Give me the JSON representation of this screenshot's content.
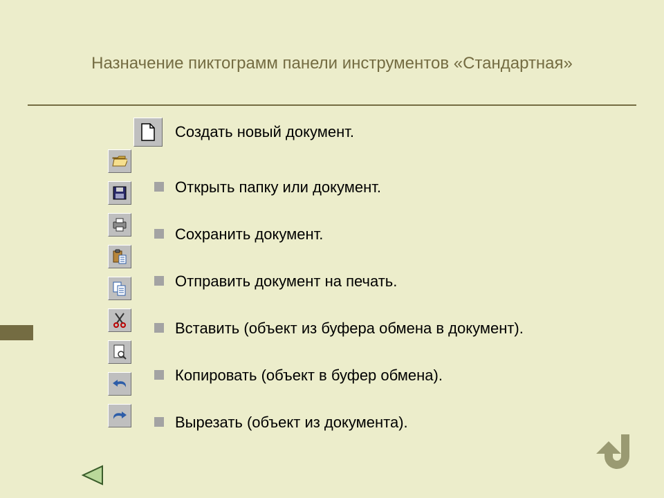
{
  "title": "Назначение пиктограмм панели инструментов «Стандартная»",
  "items": [
    {
      "label": "Создать новый документ.",
      "icon": "new-document-icon"
    },
    {
      "label": "Открыть папку или документ.",
      "icon": "open-folder-icon"
    },
    {
      "label": "Сохранить документ.",
      "icon": "save-icon"
    },
    {
      "label": "Отправить документ на печать.",
      "icon": "print-icon"
    },
    {
      "label": "Вставить (объект из буфера обмена в документ).",
      "icon": "paste-icon"
    },
    {
      "label": "Копировать (объект в буфер обмена).",
      "icon": "copy-icon"
    },
    {
      "label": "Вырезать (объект из документа).",
      "icon": "cut-icon"
    }
  ],
  "icon_column": [
    "open-folder-icon",
    "save-icon",
    "print-icon",
    "paste-icon",
    "copy-icon",
    "cut-icon",
    "preview-icon",
    "undo-icon",
    "redo-icon"
  ],
  "colors": {
    "slide_bg": "#ecedcb",
    "accent": "#746c42",
    "icon_btn_bg": "#bfbfbf"
  }
}
